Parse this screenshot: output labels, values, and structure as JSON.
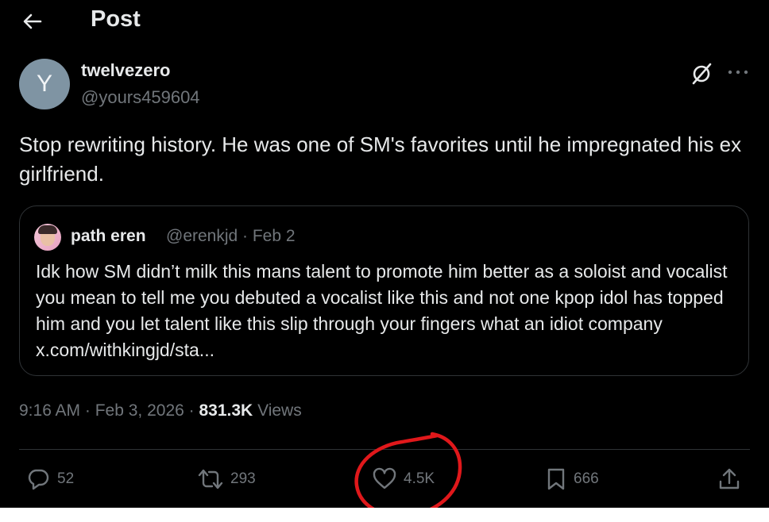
{
  "header": {
    "title": "Post"
  },
  "author": {
    "avatar_initial": "Y",
    "display_name": "twelvezero",
    "handle": "@yours459604"
  },
  "post": {
    "text": "Stop rewriting history. He was one of SM's favorites until he impregnated his ex girlfriend."
  },
  "quoted_post": {
    "display_name": "path eren",
    "meta": "@erenkjd · Feb 2",
    "text": "Idk how SM didn’t milk this mans talent to promote him better as a soloist and vocalist you mean to tell me you debuted a vocalist like this and not one  kpop idol has topped him and you let talent like this slip through your fingers what an idiot company x.com/withkingjd/sta..."
  },
  "meta": {
    "time": "9:16 AM",
    "date": "Feb 3, 2026",
    "views_count": "831.3K",
    "views_label": "Views",
    "separator": " · "
  },
  "actions": {
    "replies": "52",
    "reposts": "293",
    "likes": "4.5K",
    "bookmarks": "666"
  },
  "icons": [
    "back-arrow-icon",
    "grok-icon",
    "more-icon",
    "reply-icon",
    "repost-icon",
    "like-icon",
    "bookmark-icon",
    "share-icon"
  ],
  "colors": {
    "background": "#000000",
    "text_primary": "#e7e9ea",
    "text_secondary": "#71767b",
    "border": "#2f3336",
    "annotation_circle": "#e0181b"
  }
}
